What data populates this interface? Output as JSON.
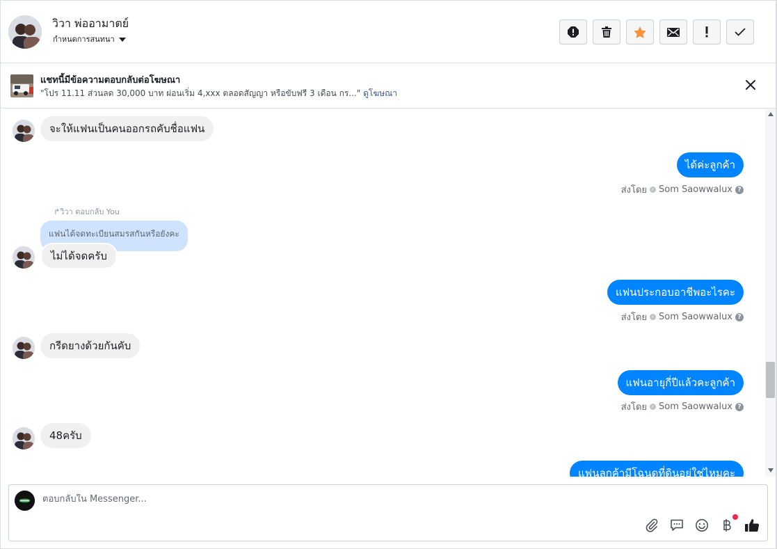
{
  "header": {
    "contact_name": "วิวา พ่ออามาตย์",
    "label_dropdown": "กำหนดการสนทนา"
  },
  "actions": [
    "spam-icon",
    "delete-icon",
    "star-icon",
    "mail-icon",
    "important-icon",
    "done-icon"
  ],
  "ad_banner": {
    "title": "แชทนี้มีข้อความตอบกลับต่อโฆษณา",
    "text": "\"โปร 11.11 ส่วนลด 30,000 บาท ผ่อนเริ่ม 4,xxx ตลอดสัญญา หรือขับฟรี 3 เดือน กร...\"",
    "link": "ดูโฆษณา"
  },
  "messages": {
    "m1": "จะให้แฟนเป็นคนออกรถคับชื่อแฟน",
    "m2": "ได้ค่ะลูกค้า",
    "m3_reply_label": "วิวา ตอบกลับ You",
    "m3_quote": "แฟนได้จดทะเบียนสมรสกันหรือยังคะ",
    "m3": "ไม่ได้จดครับ",
    "m4": "แฟนประกอบอาชีพอะไรคะ",
    "m5": "กรีดยางด้วยกันคับ",
    "m6": "แฟนอายุกี่ปีแล้วคะลูกค้า",
    "m7": "48ครับ",
    "m8": "แฟนลูกค้ามีโฉนดที่ดินอยู่ใช่ไหมคะ"
  },
  "sent_by": {
    "prefix": "ส่งโดย",
    "name": "Som Saowwalux"
  },
  "composer": {
    "placeholder": "ตอบกลับใน Messenger..."
  },
  "colors": {
    "accent": "#0084ff",
    "incoming": "#f1f0f0",
    "star": "#f7923b",
    "quote": "#cfe3ff"
  }
}
